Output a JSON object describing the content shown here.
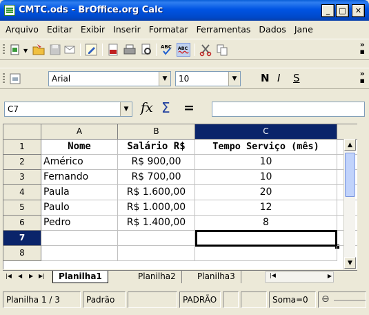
{
  "window": {
    "title": "CMTC.ods - BrOffice.org Calc",
    "minimize": "_",
    "maximize": "□",
    "close": "✕"
  },
  "menu": [
    "Arquivo",
    "Editar",
    "Exibir",
    "Inserir",
    "Formatar",
    "Ferramentas",
    "Dados",
    "Jane"
  ],
  "format_toolbar": {
    "font": "Arial",
    "size": "10",
    "bold": "N",
    "italic": "I",
    "underline": "S"
  },
  "formula_bar": {
    "cell_ref": "C7",
    "fx": "fx",
    "sum": "Σ",
    "equals": "=",
    "content": ""
  },
  "sheet": {
    "columns": [
      "A",
      "B",
      "C"
    ],
    "rows": [
      {
        "num": "1",
        "a": "Nome",
        "b": "Salário R$",
        "c": "Tempo Serviço (mês)"
      },
      {
        "num": "2",
        "a": "Américo",
        "b": "R$ 900,00",
        "c": "10"
      },
      {
        "num": "3",
        "a": "Fernando",
        "b": "R$ 700,00",
        "c": "10"
      },
      {
        "num": "4",
        "a": "Paula",
        "b": "R$ 1.600,00",
        "c": "20"
      },
      {
        "num": "5",
        "a": "Paulo",
        "b": "R$ 1.000,00",
        "c": "12"
      },
      {
        "num": "6",
        "a": "Pedro",
        "b": "R$ 1.400,00",
        "c": "8"
      },
      {
        "num": "7",
        "a": "",
        "b": "",
        "c": ""
      },
      {
        "num": "8",
        "a": "",
        "b": "",
        "c": ""
      }
    ],
    "active_cell": "C7"
  },
  "tabs": [
    "Planilha1",
    "Planilha2",
    "Planilha3"
  ],
  "active_tab": "Planilha1",
  "status": {
    "sheet": "Planilha 1 / 3",
    "style": "Padrão",
    "mode": "PADRÃO",
    "sum": "Soma=0"
  },
  "colors": {
    "title_bar": "#0054e3",
    "selection": "#000000",
    "column_selected": "#0a246a"
  }
}
